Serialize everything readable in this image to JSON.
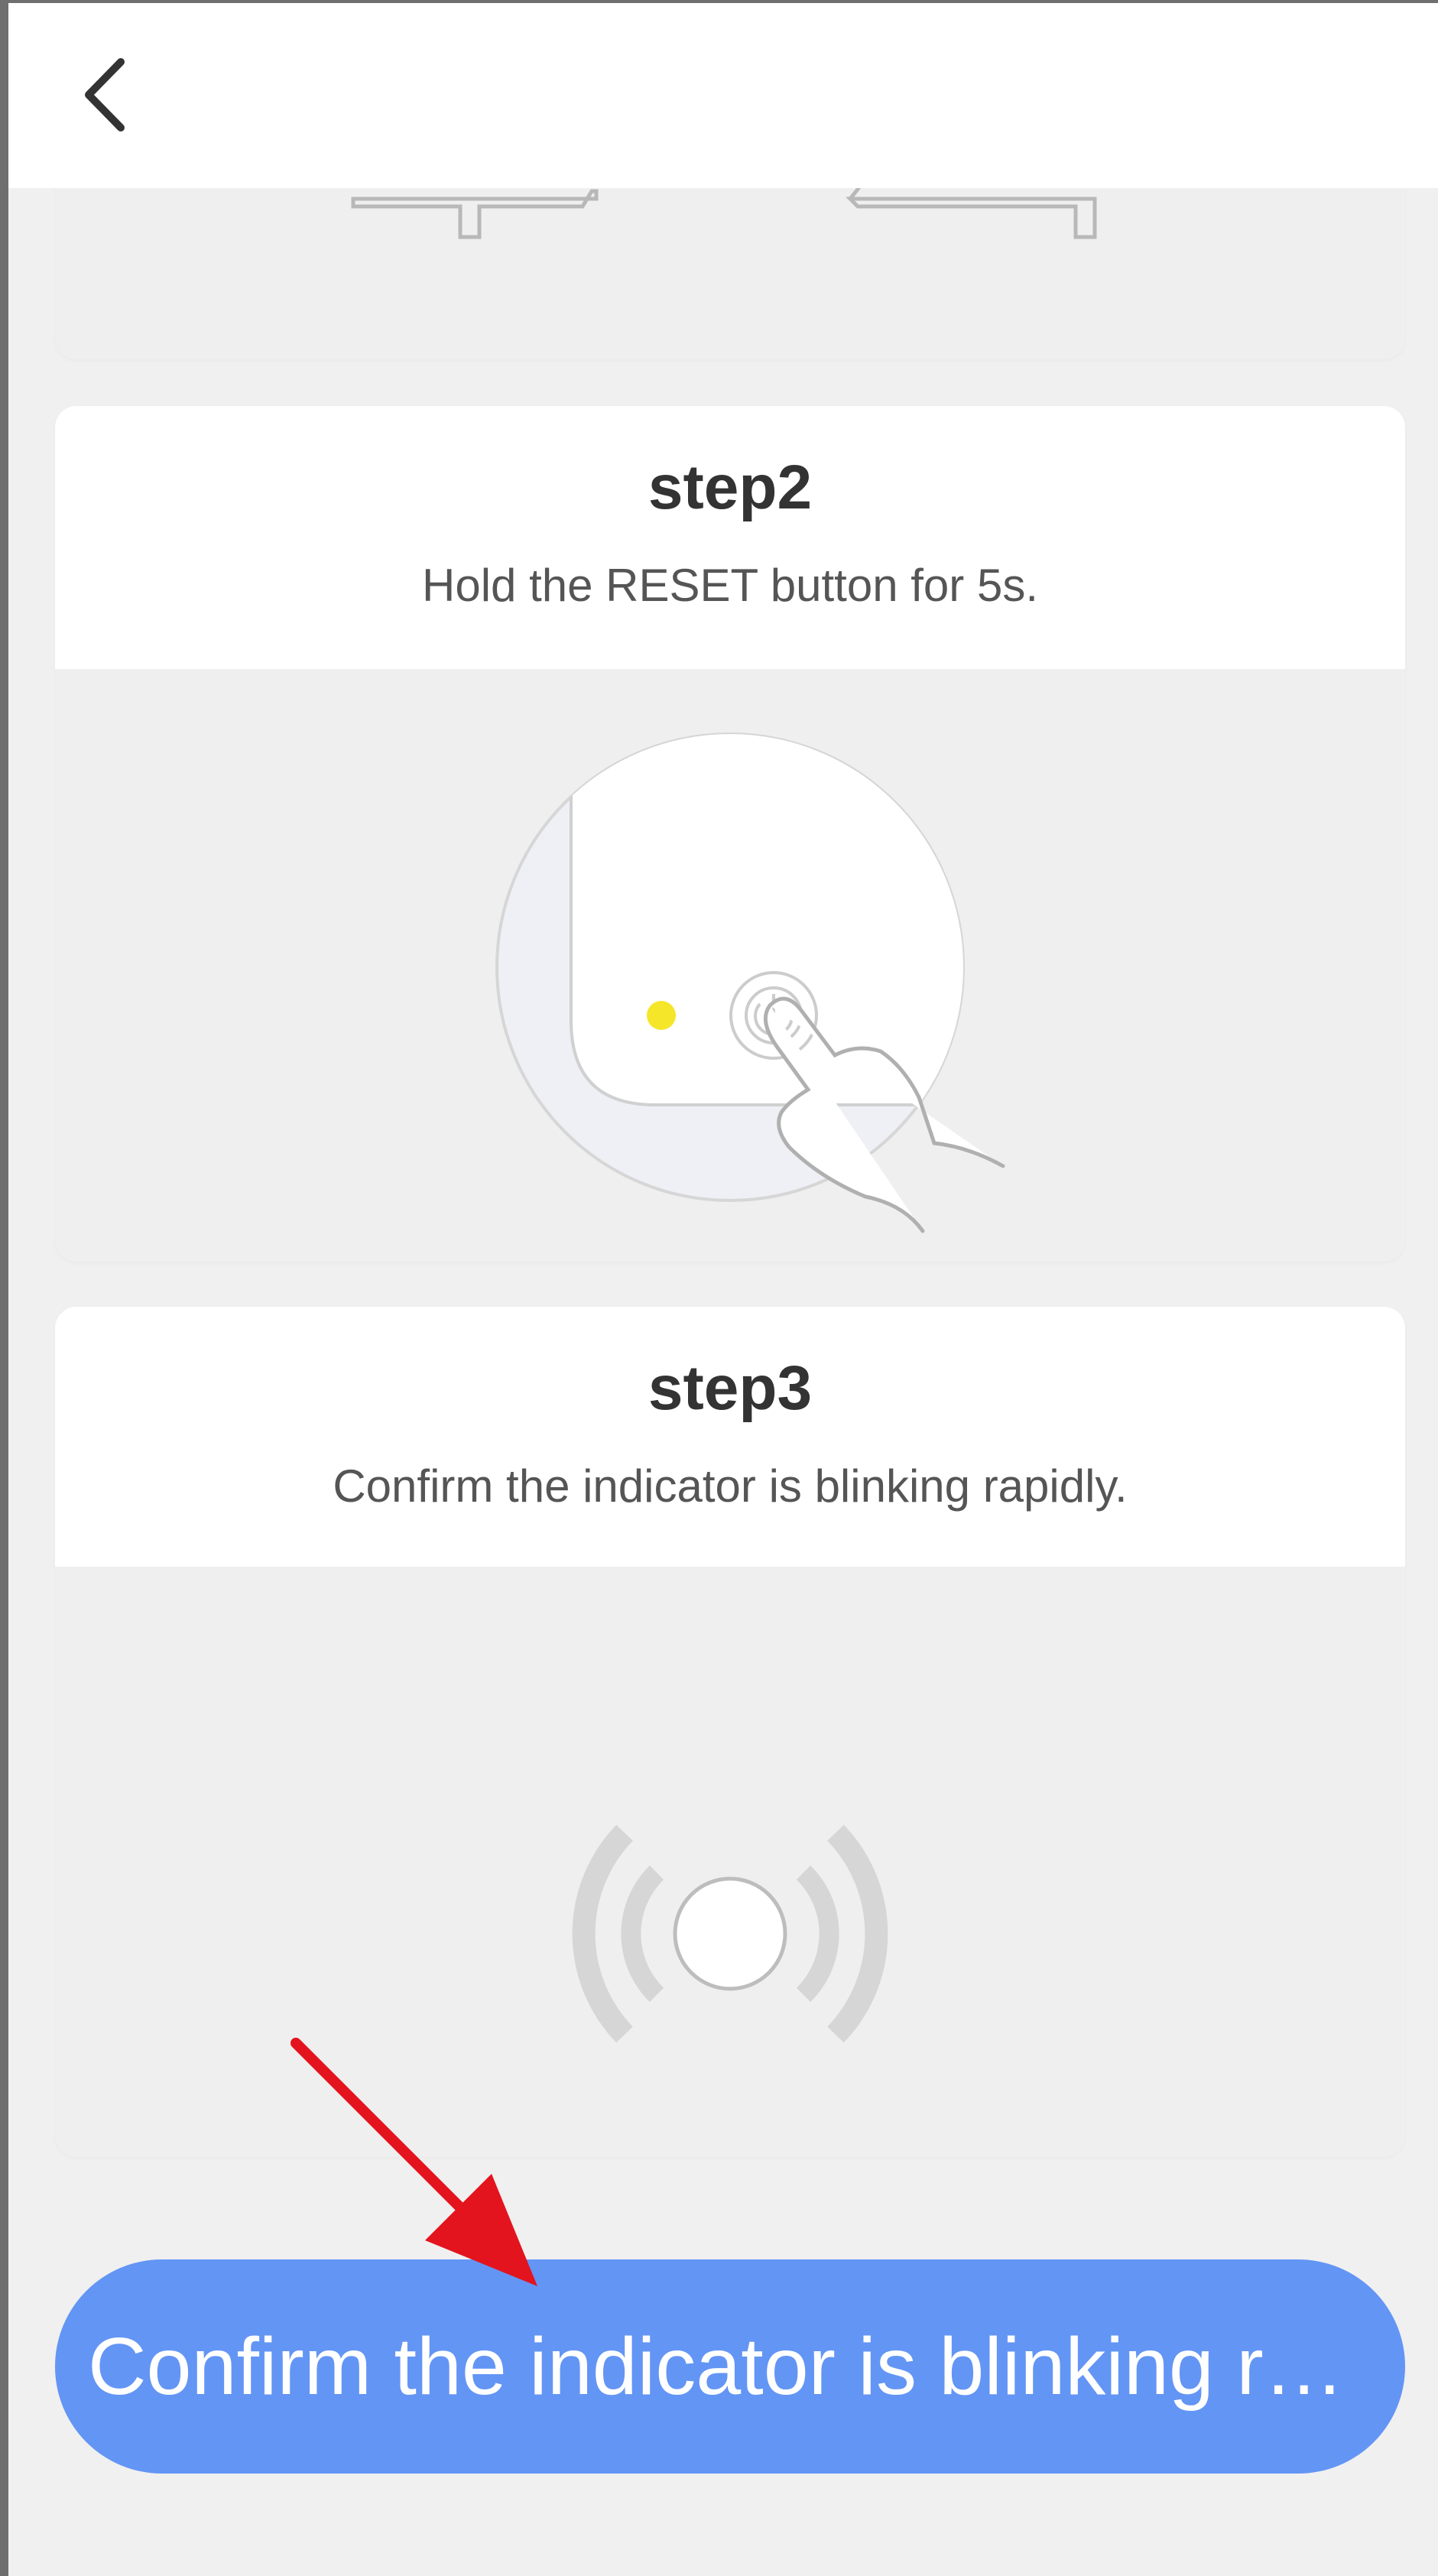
{
  "header": {
    "back_icon": "chevron-left-icon"
  },
  "steps": [
    {
      "title": "step2",
      "description": "Hold the RESET button for 5s.",
      "illustration": "device-reset-button-press-illustration"
    },
    {
      "title": "step3",
      "description": "Confirm the indicator is blinking rapidly.",
      "illustration": "blinking-indicator-illustration"
    }
  ],
  "confirm_button": {
    "label": "Confirm the indicator is blinking ra…"
  },
  "colors": {
    "primary_button": "#6395f5",
    "annotation_arrow": "#e3141e",
    "indicator_led": "#f5e62a"
  }
}
